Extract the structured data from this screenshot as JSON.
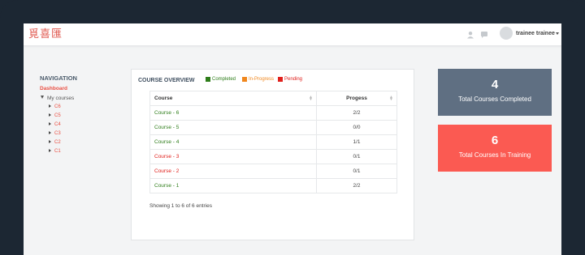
{
  "header": {
    "logo_text": "覓喜匯",
    "user_name": "trainee trainee",
    "icons": [
      "user-icon",
      "chat-icon",
      "avatar",
      "chevron-down-icon"
    ]
  },
  "navigation": {
    "title": "NAVIGATION",
    "dashboard": "Dashboard",
    "my_courses": "My courses",
    "courses": [
      "C6",
      "C5",
      "C4",
      "C3",
      "C2",
      "C1"
    ]
  },
  "overview": {
    "title": "COURSE OVERVIEW",
    "legend": [
      {
        "label": "Completed",
        "color": "#2e7d1a"
      },
      {
        "label": "In-Progress",
        "color": "#f0871e"
      },
      {
        "label": "Pending",
        "color": "#e0201c"
      }
    ],
    "columns": [
      "Course",
      "Progess"
    ],
    "rows": [
      {
        "course": "Course - 6",
        "progress": "2/2",
        "status": "completed"
      },
      {
        "course": "Course - 5",
        "progress": "0/0",
        "status": "completed"
      },
      {
        "course": "Course - 4",
        "progress": "1/1",
        "status": "completed"
      },
      {
        "course": "Course - 3",
        "progress": "0/1",
        "status": "pending"
      },
      {
        "course": "Course - 2",
        "progress": "0/1",
        "status": "pending"
      },
      {
        "course": "Course - 1",
        "progress": "2/2",
        "status": "completed"
      }
    ],
    "showing": "Showing 1 to 6 of 6 entries"
  },
  "cards": [
    {
      "number": "4",
      "label": "Total Courses Completed",
      "color": "#5f6f82"
    },
    {
      "number": "6",
      "label": "Total Courses In Training",
      "color": "#fb5a52"
    }
  ],
  "colors": {
    "completed": "#2e7d1a",
    "pending": "#e0201c",
    "accent": "#ea4e42"
  }
}
